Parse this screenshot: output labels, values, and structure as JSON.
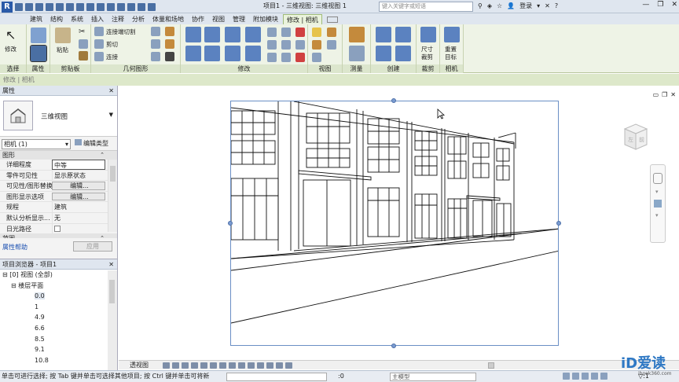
{
  "title": {
    "text": "项目1 - 三维视图: 三维视图 1",
    "search_placeholder": "键入关键字或短语",
    "login": "登录"
  },
  "tabs": [
    "建筑",
    "结构",
    "系统",
    "插入",
    "注释",
    "分析",
    "体量和场地",
    "协作",
    "视图",
    "管理",
    "附加模块",
    "修改 | 相机"
  ],
  "ribbon": {
    "modify_label": "修改",
    "paste_label": "粘贴",
    "join_label": "连接端切割",
    "cut_label": "剪切",
    "connect_label": "连接",
    "crop_label": "尺寸\n裁剪",
    "reset_label": "重置\n目标",
    "panels": [
      "选择",
      "属性",
      "剪贴板",
      "几何图形",
      "修改",
      "视图",
      "测量",
      "创建",
      "裁剪",
      "相机"
    ]
  },
  "options_bar": "修改 | 相机",
  "properties": {
    "header": "属性",
    "type_name": "三维视图",
    "instance": "相机 (1)",
    "edit_type": "编辑类型",
    "group_graphics": "图形",
    "rows": [
      {
        "k": "详细程度",
        "v": "中等"
      },
      {
        "k": "零件可见性",
        "v": "显示原状态"
      },
      {
        "k": "可见性/图形替换",
        "v": "编辑..."
      },
      {
        "k": "图形显示选项",
        "v": "编辑..."
      },
      {
        "k": "规程",
        "v": "建筑"
      },
      {
        "k": "默认分析显示...",
        "v": "无"
      },
      {
        "k": "日光路径",
        "v": ""
      }
    ],
    "group_range": "范围",
    "help": "属性帮助",
    "apply": "应用"
  },
  "browser": {
    "header": "项目浏览器 - 项目1",
    "nodes": [
      {
        "label": "[0] 视图 (全部)",
        "level": 0
      },
      {
        "label": "楼层平面",
        "level": 1
      },
      {
        "label": "0.0",
        "level": 2
      },
      {
        "label": "1",
        "level": 2
      },
      {
        "label": "4.9",
        "level": 2
      },
      {
        "label": "6.6",
        "level": 2
      },
      {
        "label": "8.5",
        "level": 2
      },
      {
        "label": "9.1",
        "level": 2
      },
      {
        "label": "10.8",
        "level": 2
      }
    ]
  },
  "view_control": {
    "view_name": "透视图"
  },
  "status": {
    "text": "单击可进行选择; 按 Tab 键并单击可选择其他项目; 按 Ctrl 键并单击可将新",
    "coord": ":0",
    "model": "主模型",
    "filter": ":1"
  },
  "viewcube": {
    "left": "左",
    "front": "前"
  },
  "watermark": {
    "main": "iD爱读",
    "sub": "ibook360.com"
  },
  "colors": {
    "accent_tab": "#eaf3dc",
    "frame": "#6a8fc5"
  }
}
